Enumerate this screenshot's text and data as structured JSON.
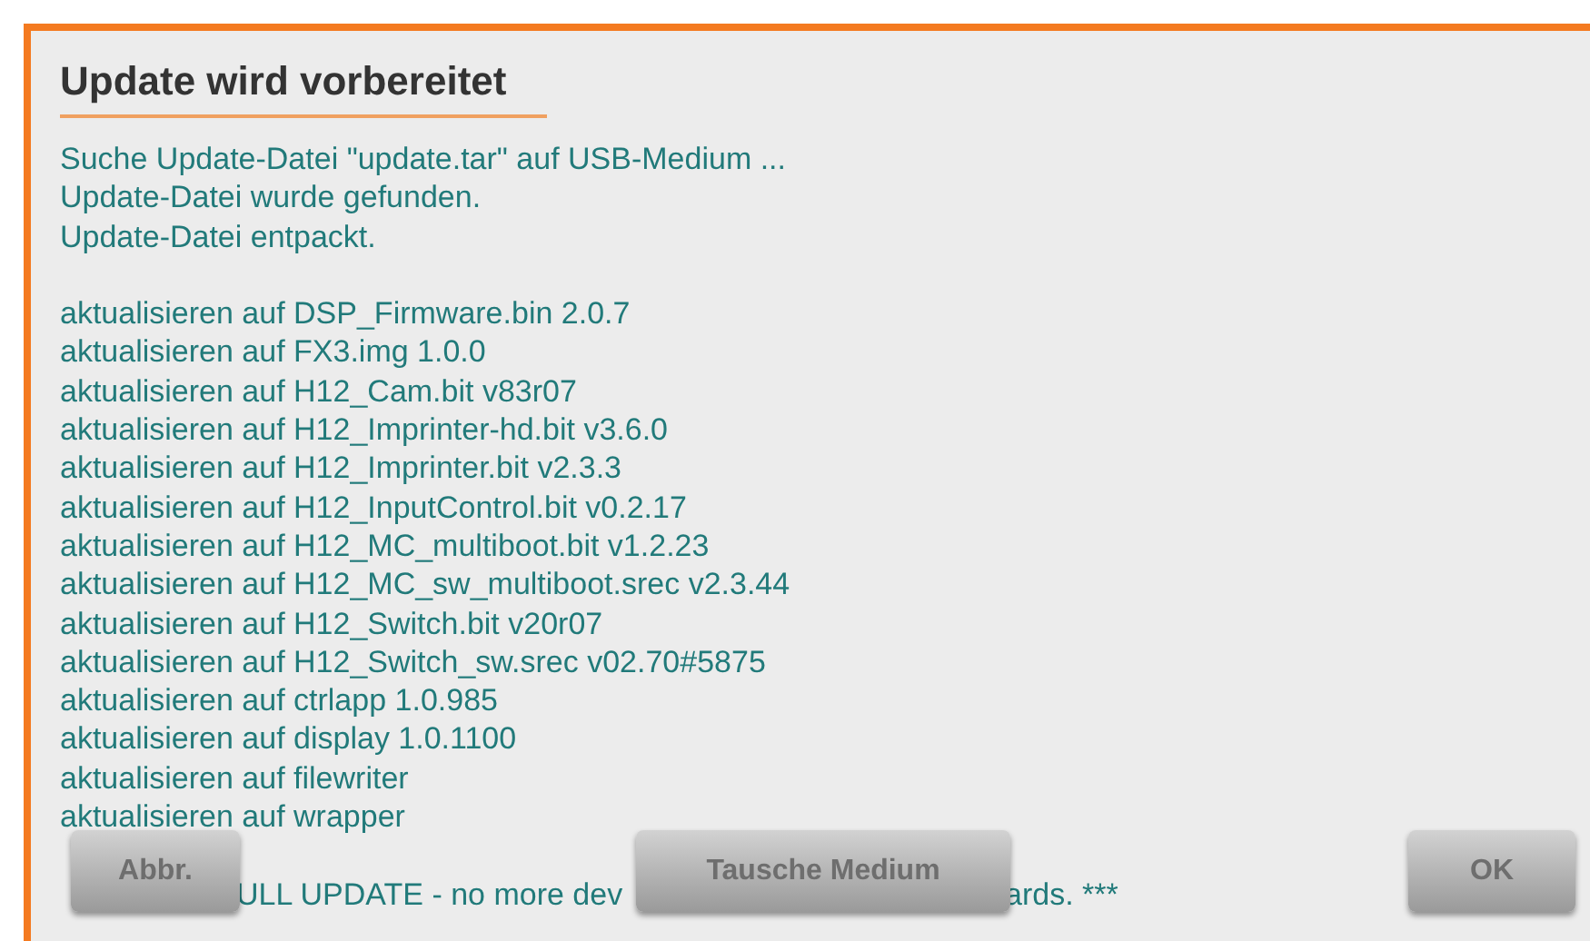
{
  "dialog": {
    "title": "Update wird vorbereitet",
    "intro_lines": [
      "Suche Update-Datei \"update.tar\" auf USB-Medium ...",
      "Update-Datei wurde gefunden.",
      "Update-Datei entpackt."
    ],
    "update_lines": [
      "aktualisieren auf DSP_Firmware.bin 2.0.7",
      "aktualisieren auf FX3.img 1.0.0",
      "aktualisieren auf H12_Cam.bit v83r07",
      "aktualisieren auf H12_Imprinter-hd.bit v3.6.0",
      "aktualisieren auf H12_Imprinter.bit v2.3.3",
      "aktualisieren auf H12_InputControl.bit v0.2.17",
      "aktualisieren auf H12_MC_multiboot.bit v1.2.23",
      "aktualisieren auf H12_MC_sw_multiboot.srec v2.3.44",
      "aktualisieren auf H12_Switch.bit v20r07",
      "aktualisieren auf H12_Switch_sw.srec v02.70#5875",
      "aktualisieren auf ctrlapp 1.0.985",
      "aktualisieren auf display 1.0.1100",
      "aktualisieren auf filewriter",
      "aktualisieren auf wrapper"
    ],
    "last_line_parts": [
      "ULL UPDATE - no more dev",
      "ards. ***"
    ],
    "buttons": [
      {
        "label": "Abbr."
      },
      {
        "label": "Tausche Medium"
      },
      {
        "label": "OK"
      }
    ]
  }
}
